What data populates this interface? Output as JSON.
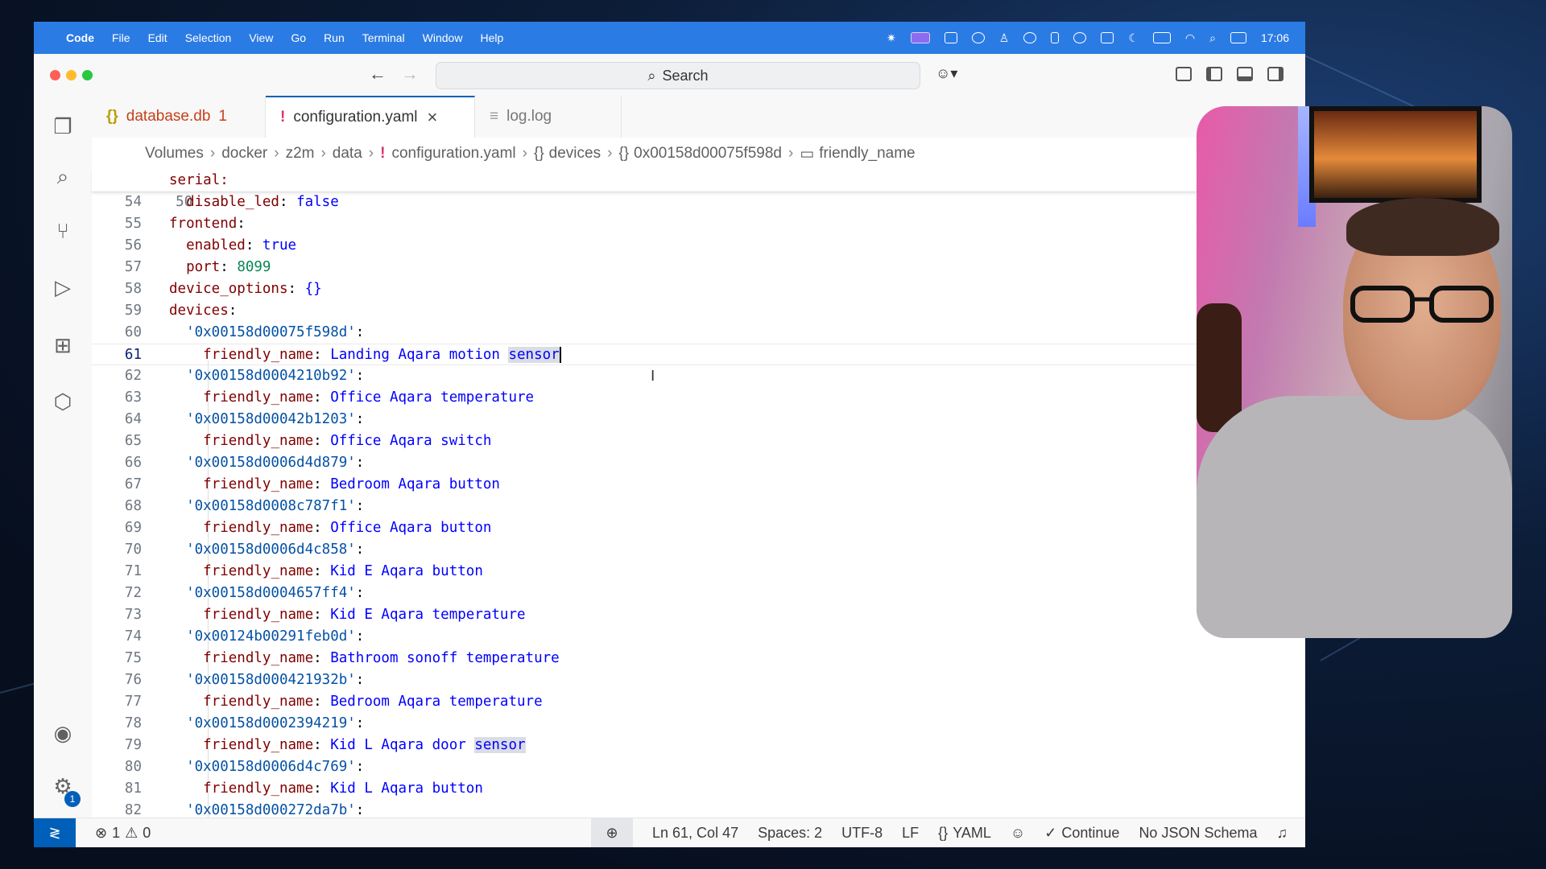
{
  "menubar": {
    "app": "Code",
    "items": [
      "File",
      "Edit",
      "Selection",
      "View",
      "Go",
      "Run",
      "Terminal",
      "Window",
      "Help"
    ],
    "time": "17:06"
  },
  "titlebar": {
    "search_label": "Search"
  },
  "tabs": [
    {
      "icon": "{}",
      "label": "database.db",
      "badge": "1",
      "color": "#c5411b"
    },
    {
      "icon": "!",
      "label": "configuration.yaml",
      "close": "×",
      "color": "#333333"
    },
    {
      "icon": "≡",
      "label": "log.log",
      "color": "#777777"
    }
  ],
  "breadcrumbs": [
    "Volumes",
    "docker",
    "z2m",
    "data",
    "configuration.yaml",
    "devices",
    "0x00158d00075f598d",
    "friendly_name"
  ],
  "editor": {
    "sticky": {
      "ln": "50",
      "text": "serial:"
    },
    "lines": [
      {
        "ln": "54",
        "key": "disable_led",
        "sep": ": ",
        "val": "false",
        "indent": "  ",
        "cls": "val"
      },
      {
        "ln": "55",
        "key": "frontend",
        "sep": ":",
        "val": "",
        "indent": "",
        "cls": "val"
      },
      {
        "ln": "56",
        "key": "enabled",
        "sep": ": ",
        "val": "true",
        "indent": "  ",
        "cls": "val"
      },
      {
        "ln": "57",
        "key": "port",
        "sep": ": ",
        "val": "8099",
        "indent": "  ",
        "cls": "num"
      },
      {
        "ln": "58",
        "key": "device_options",
        "sep": ": ",
        "val": "{}",
        "indent": "",
        "cls": "val"
      },
      {
        "ln": "59",
        "key": "devices",
        "sep": ":",
        "val": "",
        "indent": "",
        "cls": "val"
      },
      {
        "ln": "60",
        "key": "'0x00158d00075f598d'",
        "sep": ":",
        "val": "",
        "indent": "  ",
        "cls": "val",
        "strkey": true
      },
      {
        "ln": "61",
        "key": "friendly_name",
        "sep": ": ",
        "val": "Landing Aqara motion ",
        "hl": "sensor",
        "indent": "    ",
        "cls": "val",
        "current": true
      },
      {
        "ln": "62",
        "key": "'0x00158d0004210b92'",
        "sep": ":",
        "val": "",
        "indent": "  ",
        "cls": "val",
        "strkey": true
      },
      {
        "ln": "63",
        "key": "friendly_name",
        "sep": ": ",
        "val": "Office Aqara temperature",
        "indent": "    ",
        "cls": "val"
      },
      {
        "ln": "64",
        "key": "'0x00158d00042b1203'",
        "sep": ":",
        "val": "",
        "indent": "  ",
        "cls": "val",
        "strkey": true
      },
      {
        "ln": "65",
        "key": "friendly_name",
        "sep": ": ",
        "val": "Office Aqara switch",
        "indent": "    ",
        "cls": "val"
      },
      {
        "ln": "66",
        "key": "'0x00158d0006d4d879'",
        "sep": ":",
        "val": "",
        "indent": "  ",
        "cls": "val",
        "strkey": true
      },
      {
        "ln": "67",
        "key": "friendly_name",
        "sep": ": ",
        "val": "Bedroom Aqara button",
        "indent": "    ",
        "cls": "val"
      },
      {
        "ln": "68",
        "key": "'0x00158d0008c787f1'",
        "sep": ":",
        "val": "",
        "indent": "  ",
        "cls": "val",
        "strkey": true
      },
      {
        "ln": "69",
        "key": "friendly_name",
        "sep": ": ",
        "val": "Office Aqara button",
        "indent": "    ",
        "cls": "val"
      },
      {
        "ln": "70",
        "key": "'0x00158d0006d4c858'",
        "sep": ":",
        "val": "",
        "indent": "  ",
        "cls": "val",
        "strkey": true
      },
      {
        "ln": "71",
        "key": "friendly_name",
        "sep": ": ",
        "val": "Kid E Aqara button",
        "indent": "    ",
        "cls": "val"
      },
      {
        "ln": "72",
        "key": "'0x00158d0004657ff4'",
        "sep": ":",
        "val": "",
        "indent": "  ",
        "cls": "val",
        "strkey": true
      },
      {
        "ln": "73",
        "key": "friendly_name",
        "sep": ": ",
        "val": "Kid E Aqara temperature",
        "indent": "    ",
        "cls": "val"
      },
      {
        "ln": "74",
        "key": "'0x00124b00291feb0d'",
        "sep": ":",
        "val": "",
        "indent": "  ",
        "cls": "val",
        "strkey": true
      },
      {
        "ln": "75",
        "key": "friendly_name",
        "sep": ": ",
        "val": "Bathroom sonoff temperature",
        "indent": "    ",
        "cls": "val"
      },
      {
        "ln": "76",
        "key": "'0x00158d000421932b'",
        "sep": ":",
        "val": "",
        "indent": "  ",
        "cls": "val",
        "strkey": true
      },
      {
        "ln": "77",
        "key": "friendly_name",
        "sep": ": ",
        "val": "Bedroom Aqara temperature",
        "indent": "    ",
        "cls": "val"
      },
      {
        "ln": "78",
        "key": "'0x00158d0002394219'",
        "sep": ":",
        "val": "",
        "indent": "  ",
        "cls": "val",
        "strkey": true
      },
      {
        "ln": "79",
        "key": "friendly_name",
        "sep": ": ",
        "val": "Kid L Aqara door ",
        "hl": "sensor",
        "indent": "    ",
        "cls": "val"
      },
      {
        "ln": "80",
        "key": "'0x00158d0006d4c769'",
        "sep": ":",
        "val": "",
        "indent": "  ",
        "cls": "val",
        "strkey": true
      },
      {
        "ln": "81",
        "key": "friendly_name",
        "sep": ": ",
        "val": "Kid L Aqara button",
        "indent": "    ",
        "cls": "val"
      },
      {
        "ln": "82",
        "key": "'0x00158d000272da7b'",
        "sep": ":",
        "val": "",
        "indent": "  ",
        "cls": "val",
        "strkey": true
      }
    ]
  },
  "statusbar": {
    "errors": "1",
    "warnings": "0",
    "position": "Ln 61, Col 47",
    "spaces": "Spaces: 2",
    "encoding": "UTF-8",
    "eol": "LF",
    "language": "YAML",
    "continue": "Continue",
    "schema": "No JSON Schema"
  },
  "activity_badge": "1",
  "colors": {
    "accent": "#005fb8",
    "menubar": "#2b7be4",
    "yaml_key": "#800000",
    "yaml_string": "#0451a5",
    "yaml_value": "#0000ff",
    "yaml_number": "#098658"
  }
}
